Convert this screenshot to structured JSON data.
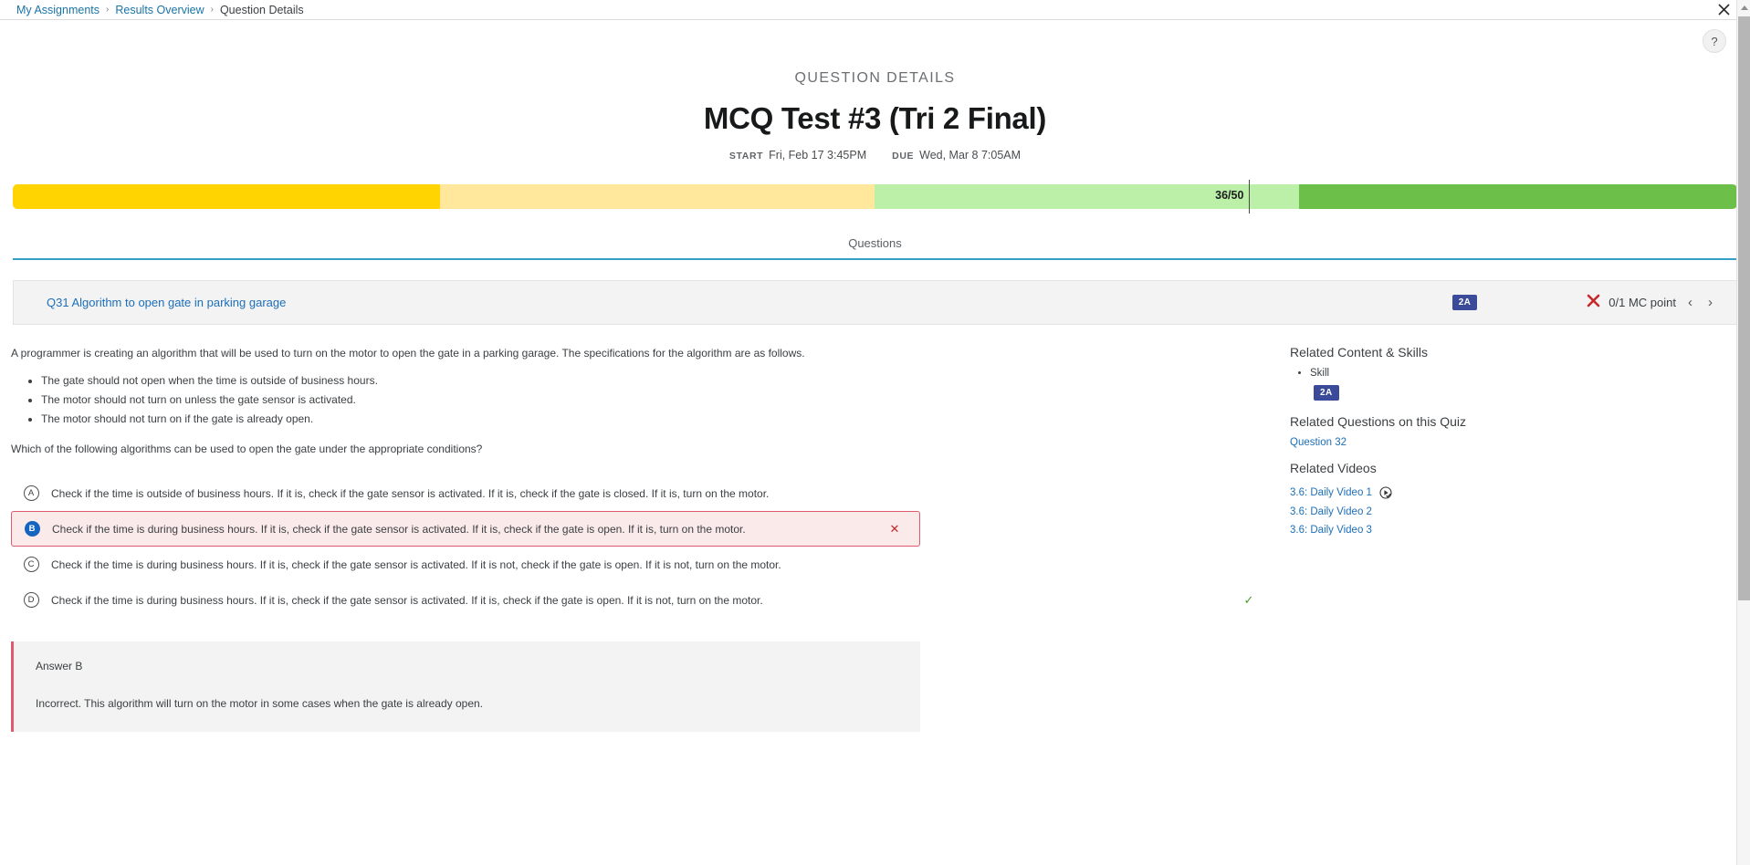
{
  "breadcrumb": {
    "items": [
      {
        "label": "My Assignments",
        "link": true
      },
      {
        "label": "Results Overview",
        "link": true
      },
      {
        "label": "Question Details",
        "link": false
      }
    ],
    "separator": "›"
  },
  "window": {
    "close_icon": "close-icon",
    "help_label": "?"
  },
  "header": {
    "kicker": "QUESTION DETAILS",
    "title": "MCQ Test #3 (Tri 2 Final)",
    "start_label": "START",
    "start_value": "Fri, Feb 17 3:45PM",
    "due_label": "DUE",
    "due_value": "Wed, Mar 8 7:05AM"
  },
  "score_bar": {
    "label": "36/50",
    "segments": [
      {
        "name": "gold",
        "color": "#FFD400",
        "width_pct": 24.8
      },
      {
        "name": "light-yellow",
        "color": "#FFE79C",
        "width_pct": 25.2
      },
      {
        "name": "light-green",
        "color": "#BCF0A8",
        "width_pct": 24.6
      },
      {
        "name": "green",
        "color": "#6CC04A",
        "width_pct": 25.4
      }
    ],
    "marker_pct": 71.7
  },
  "tabs": [
    {
      "label": "Questions",
      "active": true
    }
  ],
  "question_header": {
    "title": "Q31 Algorithm to open gate in parking garage",
    "skill_badge": "2A",
    "result_icon": "x-mark-icon",
    "points": "0/1 MC point",
    "prev_icon": "‹",
    "next_icon": "›"
  },
  "question": {
    "stem": "A programmer is creating an algorithm that will be used to turn on the motor to open the gate in a parking garage. The specifications for the algorithm are as follows.",
    "bullets": [
      "The gate should not open when the time is outside of business hours.",
      "The motor should not turn on unless the gate sensor is activated.",
      "The motor should not turn on if the gate is already open."
    ],
    "prompt": "Which of the following algorithms can be used to open the gate under the appropriate conditions?",
    "choices": [
      {
        "letter": "A",
        "text": "Check if the time is outside of business hours. If it is, check if the gate sensor is activated. If it is, check if the gate is closed. If it is, turn on the motor.",
        "state": "none",
        "mark": ""
      },
      {
        "letter": "B",
        "text": "Check if the time is during business hours. If it is, check if the gate sensor is activated. If it is, check if the gate is open. If it is, turn on the motor.",
        "state": "selected-wrong",
        "mark": "✕"
      },
      {
        "letter": "C",
        "text": "Check if the time is during business hours. If it is, check if the gate sensor is activated. If it is not, check if the gate is open. If it is not, turn on the motor.",
        "state": "none",
        "mark": ""
      },
      {
        "letter": "D",
        "text": "Check if the time is during business hours. If it is, check if the gate sensor is activated. If it is, check if the gate is open. If it is not, turn on the motor.",
        "state": "correct",
        "mark": "✓"
      }
    ]
  },
  "rationale": {
    "title": "Answer B",
    "body": "Incorrect. This algorithm will turn on the motor in some cases when the gate is already open."
  },
  "sidebar": {
    "related_content_heading": "Related Content & Skills",
    "skill_label": "Skill",
    "skill_badge": "2A",
    "related_questions_heading": "Related Questions on this Quiz",
    "related_questions": [
      {
        "label": "Question 32"
      }
    ],
    "related_videos_heading": "Related Videos",
    "related_videos": [
      {
        "label": "3.6: Daily Video 1",
        "watched": true
      },
      {
        "label": "3.6: Daily Video 2",
        "watched": false
      },
      {
        "label": "3.6: Daily Video 3",
        "watched": false
      }
    ]
  }
}
